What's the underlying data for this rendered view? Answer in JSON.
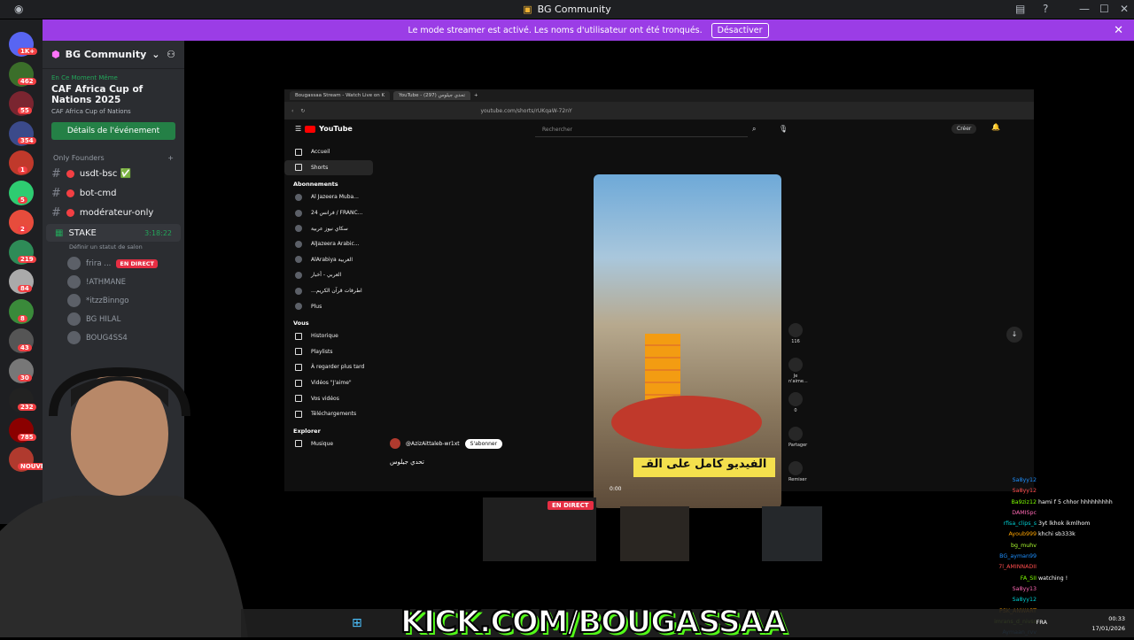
{
  "window": {
    "title": "BG Community"
  },
  "banner": {
    "text": "Le mode streamer est activé. Les noms d'utilisateur ont été tronqués.",
    "button": "Désactiver"
  },
  "rail": {
    "badges": [
      "1K+",
      "462",
      "55",
      "354",
      "1",
      "5",
      "2",
      "219",
      "84",
      "8",
      "43",
      "30",
      "232",
      "785",
      "NOUVE"
    ]
  },
  "server": {
    "name": "BG Community"
  },
  "event": {
    "live_label": "En Ce Moment Même",
    "title": "CAF Africa Cup of Nations 2025",
    "subtitle": "CAF Africa Cup of Nations",
    "button": "Détails de l'événement"
  },
  "category": {
    "name": "Only Founders"
  },
  "channels": [
    {
      "name": "usdt-bsc ✅"
    },
    {
      "name": "bot-cmd"
    },
    {
      "name": "modérateur-only"
    }
  ],
  "voice": {
    "name": "STAKE",
    "timer": "3:18:22",
    "status": "Définir un statut de salon",
    "users": [
      {
        "name": "frira ...",
        "badge": "EN DIRECT"
      },
      {
        "name": "!ATHMANE"
      },
      {
        "name": "*itzzBinngo"
      },
      {
        "name": "BG HILAL"
      },
      {
        "name": "BOUG4SS4"
      }
    ]
  },
  "browser": {
    "tabs": [
      "Bougassaa Stream - Watch Live on K",
      "YouTube - تحدي جيلوس (297)"
    ],
    "url": "youtube.com/shorts/rUKqaW-72nY",
    "youtube": {
      "logo": "YouTube",
      "search_placeholder": "Rechercher",
      "create": "Créer",
      "nav": [
        "Accueil",
        "Shorts"
      ],
      "subs_title": "Abonnements",
      "subs": [
        "Al Jazeera Muba...",
        "24 فرانس / FRANC...",
        "سكاي نيوز عربية",
        "AlJazeera Arabic...",
        "AlArabiya العربية",
        "العربي - أخبار",
        "...اطرفات قرآن الكريم",
        "Plus"
      ],
      "you_title": "Vous",
      "you": [
        "Historique",
        "Playlists",
        "À regarder plus tard",
        "Vidéos \"J'aime\"",
        "Vos vidéos",
        "Téléchargements"
      ],
      "explore_title": "Explorer",
      "explore": [
        "Musique"
      ],
      "channel": "@AzizAittaleb-wr1xt",
      "subscribe": "S'abonner",
      "video_title": "تحدي جيلوس",
      "caption": "الفيديو كامل على القـ",
      "time": "0:00",
      "actions": [
        {
          "label": "116"
        },
        {
          "label": "Je n'aime..."
        },
        {
          "label": "0"
        },
        {
          "label": "Partager"
        },
        {
          "label": "Remixer"
        }
      ]
    }
  },
  "stream": {
    "live_badge": "EN DIRECT",
    "overlay": "KICK.COM/BOUGASSAA"
  },
  "chat": [
    {
      "user": "Sa8yy12",
      "msg": ""
    },
    {
      "user": "Sa8yy12",
      "msg": ""
    },
    {
      "user": "Ba9ziz12",
      "msg": "hami f 5 chhor hhhhhhhhh"
    },
    {
      "user": "DAMISpc",
      "msg": ""
    },
    {
      "user": "rfisa_clips_s",
      "msg": "3yt lkhok ikmlhom"
    },
    {
      "user": "Ayoub999",
      "msg": "khchi sb333k"
    },
    {
      "user": "bg_muhv",
      "msg": ""
    },
    {
      "user": "BG_ayman99",
      "msg": ""
    },
    {
      "user": "7l_AMINNADII",
      "msg": ""
    },
    {
      "user": "FA_SII",
      "msg": "watching !"
    },
    {
      "user": "Sa8yy13",
      "msg": ""
    },
    {
      "user": "Sa8yy12",
      "msg": ""
    },
    {
      "user": "PSK_ANWART",
      "msg": ""
    },
    {
      "user": "imrans_d_nivss",
      "msg": ""
    },
    {
      "user": "Aymaan_rvv",
      "msg": ""
    }
  ],
  "taskbar": {
    "lang": "FRA",
    "time": "00:33",
    "date": "17/01/2026"
  },
  "colors": {
    "discord_purple": "#9b3de6",
    "kick_green": "#53fc18",
    "live_red": "#e62e43",
    "join_green": "#248046"
  }
}
